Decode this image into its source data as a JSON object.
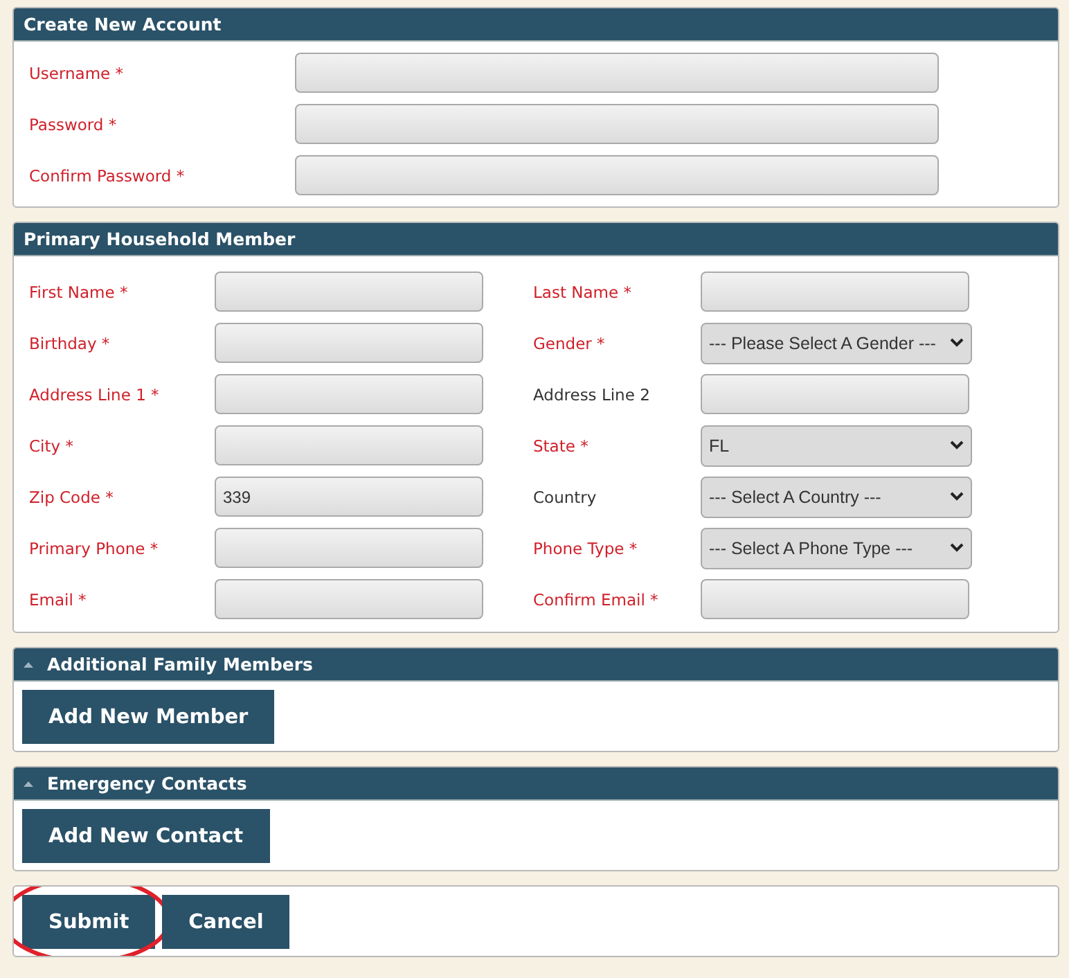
{
  "account": {
    "title": "Create New Account",
    "fields": [
      {
        "label": "Username *",
        "required": true
      },
      {
        "label": "Password *",
        "required": true
      },
      {
        "label": "Confirm Password *",
        "required": true
      }
    ]
  },
  "household": {
    "title": "Primary Household Member",
    "rows": [
      [
        {
          "label": "First Name *",
          "required": true,
          "kind": "text"
        },
        {
          "label": "Last Name *",
          "required": true,
          "kind": "text"
        }
      ],
      [
        {
          "label": "Birthday *",
          "required": true,
          "kind": "text"
        },
        {
          "label": "Gender *",
          "required": true,
          "kind": "select",
          "value": "--- Please Select A Gender ---"
        }
      ],
      [
        {
          "label": "Address Line 1 *",
          "required": true,
          "kind": "text"
        },
        {
          "label": "Address Line 2",
          "required": false,
          "kind": "text"
        }
      ],
      [
        {
          "label": "City *",
          "required": true,
          "kind": "text"
        },
        {
          "label": "State *",
          "required": true,
          "kind": "select",
          "value": "FL"
        }
      ],
      [
        {
          "label": "Zip Code *",
          "required": true,
          "kind": "text",
          "value": "339"
        },
        {
          "label": "Country",
          "required": false,
          "kind": "select",
          "value": "--- Select A Country ---"
        }
      ],
      [
        {
          "label": "Primary Phone *",
          "required": true,
          "kind": "text"
        },
        {
          "label": "Phone Type *",
          "required": true,
          "kind": "select",
          "value": "--- Select A Phone Type ---"
        }
      ],
      [
        {
          "label": "Email *",
          "required": true,
          "kind": "text"
        },
        {
          "label": "Confirm Email *",
          "required": true,
          "kind": "text"
        }
      ]
    ]
  },
  "sections": [
    {
      "title": "Additional Family Members",
      "expanded": true,
      "button": "Add New Member"
    },
    {
      "title": "Emergency Contacts",
      "expanded": true,
      "button": "Add New Contact"
    }
  ],
  "actions": [
    {
      "label": "Submit",
      "highlighted": true
    },
    {
      "label": "Cancel",
      "highlighted": false
    }
  ]
}
